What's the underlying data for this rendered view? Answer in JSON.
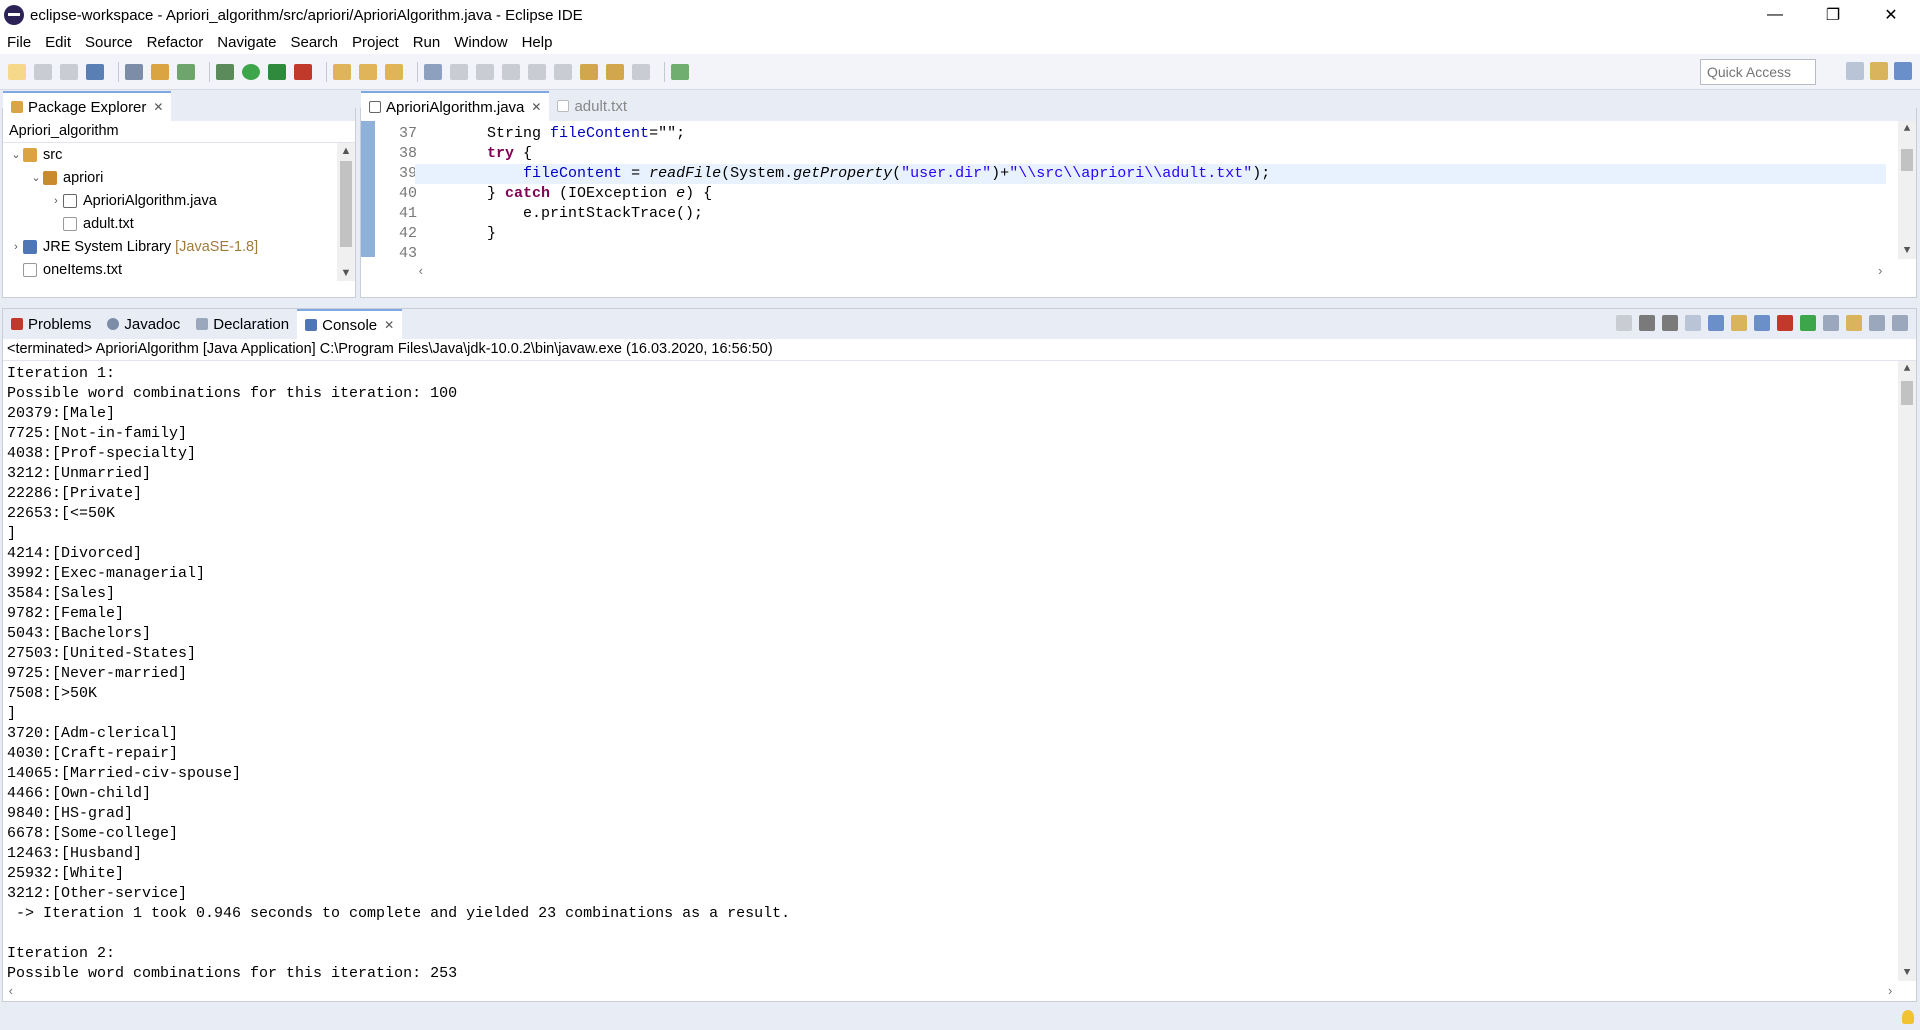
{
  "window": {
    "title": "eclipse-workspace - Apriori_algorithm/src/apriori/AprioriAlgorithm.java - Eclipse IDE"
  },
  "menu": [
    "File",
    "Edit",
    "Source",
    "Refactor",
    "Navigate",
    "Search",
    "Project",
    "Run",
    "Window",
    "Help"
  ],
  "toolbar": {
    "quick_access_placeholder": "Quick Access"
  },
  "package_explorer": {
    "tab_label": "Package Explorer",
    "project_name": "Apriori_algorithm",
    "tree": [
      {
        "label": "src",
        "decoration": ""
      },
      {
        "label": "apriori",
        "decoration": ""
      },
      {
        "label": "AprioriAlgorithm.java",
        "decoration": ""
      },
      {
        "label": "adult.txt",
        "decoration": ""
      },
      {
        "label": "JRE System Library",
        "decoration": "[JavaSE-1.8]"
      },
      {
        "label": "oneItems.txt",
        "decoration": ""
      }
    ]
  },
  "editor": {
    "tabs": [
      {
        "label": "AprioriAlgorithm.java"
      },
      {
        "label": "adult.txt"
      }
    ],
    "line_numbers": [
      "37",
      "38",
      "39",
      "40",
      "41",
      "42",
      "43"
    ],
    "lines": {
      "l37_indent": "        ",
      "l37_type": "String ",
      "l37_var": "fileContent",
      "l37_rest": "=\"\";",
      "l38_kw": "try",
      "l38_rest": " {",
      "l39_var": "fileContent",
      "l39_eq": " = ",
      "l39_method": "readFile",
      "l39_open": "(System.",
      "l39_prop": "getProperty",
      "l39_open2": "(",
      "l39_str1": "\"user.dir\"",
      "l39_plus": ")+",
      "l39_str2": "\"\\\\src\\\\apriori\\\\adult.txt\"",
      "l39_end": ");",
      "l40_brace": "} ",
      "l40_kw": "catch",
      "l40_paren": " (IOException ",
      "l40_e": "e",
      "l40_end": ") {",
      "l41_text": "e.printStackTrace();",
      "l42_text": "}",
      "l43_text": ""
    }
  },
  "bottom_tabs": [
    {
      "label": "Problems"
    },
    {
      "label": "Javadoc"
    },
    {
      "label": "Declaration"
    },
    {
      "label": "Console"
    }
  ],
  "console": {
    "header": "<terminated> AprioriAlgorithm [Java Application] C:\\Program Files\\Java\\jdk-10.0.2\\bin\\javaw.exe (16.03.2020, 16:56:50)",
    "lines": [
      "Iteration 1:",
      "Possible word combinations for this iteration: 100",
      "20379:[Male]",
      "7725:[Not-in-family]",
      "4038:[Prof-specialty]",
      "3212:[Unmarried]",
      "22286:[Private]",
      "22653:[<=50K",
      "]",
      "4214:[Divorced]",
      "3992:[Exec-managerial]",
      "3584:[Sales]",
      "9782:[Female]",
      "5043:[Bachelors]",
      "27503:[United-States]",
      "9725:[Never-married]",
      "7508:[>50K",
      "]",
      "3720:[Adm-clerical]",
      "4030:[Craft-repair]",
      "14065:[Married-civ-spouse]",
      "4466:[Own-child]",
      "9840:[HS-grad]",
      "6678:[Some-college]",
      "12463:[Husband]",
      "25932:[White]",
      "3212:[Other-service]",
      " -> Iteration 1 took 0.946 seconds to complete and yielded 23 combinations as a result.",
      "",
      "Iteration 2:",
      "Possible word combinations for this iteration: 253"
    ]
  },
  "colors": {
    "accent": "#7ea8e0",
    "keyword": "#7f0055",
    "string": "#2a00ff",
    "field": "#0000c0",
    "ruler": "#8db1d8"
  }
}
